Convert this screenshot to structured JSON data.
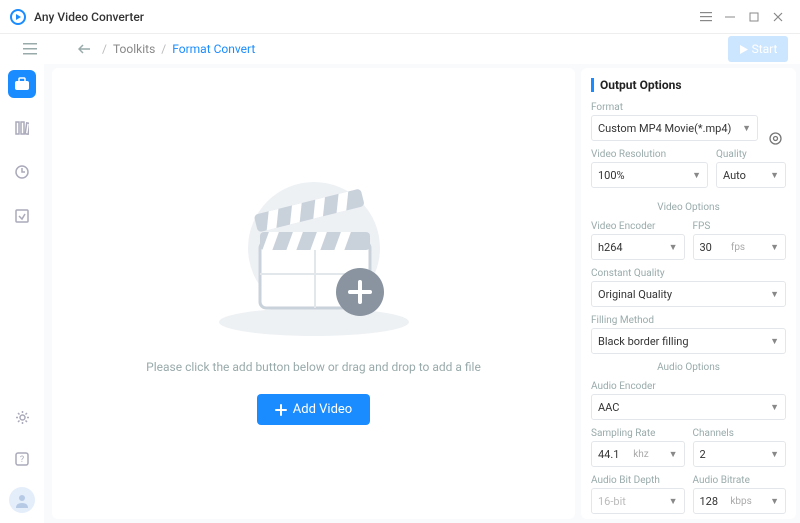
{
  "app": {
    "title": "Any Video Converter"
  },
  "breadcrumb": {
    "root": "Toolkits",
    "current": "Format Convert"
  },
  "start_label": "Start",
  "drop": {
    "hint": "Please click the add button below or drag and drop to add a file",
    "add_label": "Add Video"
  },
  "panel": {
    "title": "Output Options",
    "format": {
      "label": "Format",
      "value": "Custom MP4 Movie(*.mp4)"
    },
    "resolution": {
      "label": "Video Resolution",
      "value": "100%"
    },
    "quality": {
      "label": "Quality",
      "value": "Auto"
    },
    "video_section": "Video Options",
    "vencoder": {
      "label": "Video Encoder",
      "value": "h264"
    },
    "fps": {
      "label": "FPS",
      "value": "30",
      "unit": "fps"
    },
    "cq": {
      "label": "Constant Quality",
      "value": "Original Quality"
    },
    "fill": {
      "label": "Filling Method",
      "value": "Black border filling"
    },
    "audio_section": "Audio Options",
    "aencoder": {
      "label": "Audio Encoder",
      "value": "AAC"
    },
    "srate": {
      "label": "Sampling Rate",
      "value": "44.1",
      "unit": "khz"
    },
    "channels": {
      "label": "Channels",
      "value": "2"
    },
    "bitdepth": {
      "label": "Audio Bit Depth",
      "value": "16-bit"
    },
    "abitrate": {
      "label": "Audio Bitrate",
      "value": "128",
      "unit": "kbps"
    }
  }
}
